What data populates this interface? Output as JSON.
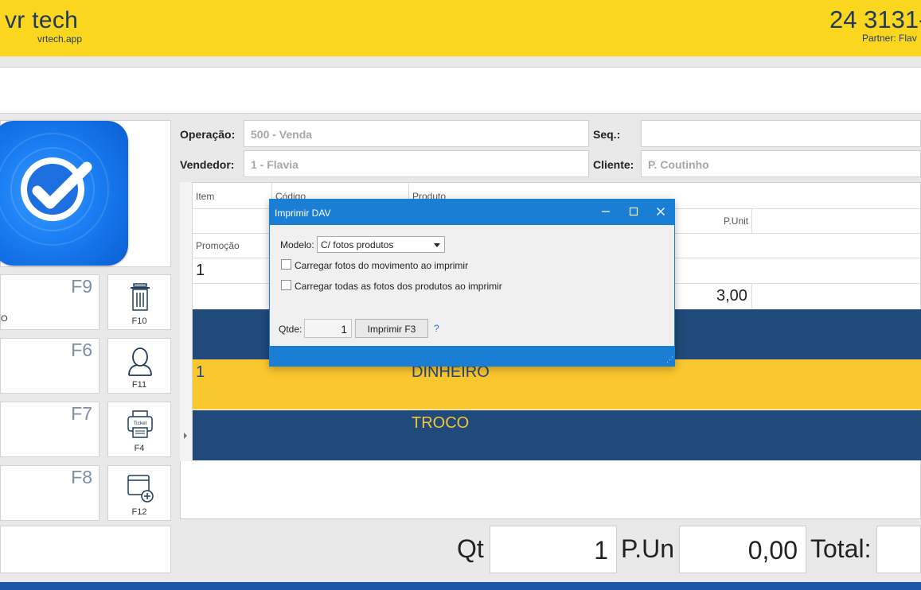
{
  "header": {
    "brand": "vr tech",
    "brand_sub": "vrtech.app",
    "phone": "24 3131-",
    "partner": "Partner: Flav"
  },
  "function_keys": [
    {
      "key": "F9",
      "fragment": "O"
    },
    {
      "key": "F6",
      "fragment": ""
    },
    {
      "key": "F7",
      "fragment": ""
    },
    {
      "key": "F8",
      "fragment": ""
    }
  ],
  "shortcut_buttons": [
    {
      "key": "F10",
      "icon": "trash-icon"
    },
    {
      "key": "F11",
      "icon": "user-icon"
    },
    {
      "key": "F4",
      "icon": "ticket-printer-icon",
      "icon_text": "Ticket"
    },
    {
      "key": "F12",
      "icon": "add-window-icon"
    }
  ],
  "form": {
    "operacao_label": "Operação:",
    "operacao_value": "500 - Venda",
    "seq_label": "Seq.:",
    "seq_value": "",
    "vendedor_label": "Vendedor:",
    "vendedor_value": "1 - Flavia",
    "cliente_label": "Cliente:",
    "cliente_value": "P. Coutinho"
  },
  "grid": {
    "headers": {
      "item": "Item",
      "codigo": "Código",
      "produto": "Produto",
      "punit": "P.Unit",
      "promocao": "Promoção"
    },
    "row_item": "1",
    "row_punit": "3,00",
    "bands": [
      {
        "item": "",
        "label": "",
        "color": "#1f4a7a"
      },
      {
        "item": "1",
        "label": "DINHEIRO",
        "color": "#fbc72f"
      },
      {
        "item": "",
        "label": "TROCO",
        "color": "#1f4a7a"
      }
    ]
  },
  "totals": {
    "qt_label": "Qt",
    "qt_value": "1",
    "pun_label": "P.Un",
    "pun_value": "0,00",
    "total_label": "Total:",
    "total_value": ""
  },
  "dialog": {
    "title": "Imprimir DAV",
    "modelo_label": "Modelo:",
    "modelo_value": "C/ fotos produtos",
    "check1": "Carregar fotos do movimento ao imprimir",
    "check2": "Carregar todas as fotos dos produtos ao imprimir",
    "qtde_label": "Qtde:",
    "qtde_value": "1",
    "print_button": "Imprimir F3",
    "help": "?"
  },
  "colors": {
    "header_yellow": "#fbd61e",
    "navy": "#1f4a7a",
    "band_yellow": "#fbc72f",
    "dialog_blue": "#1a7fd4",
    "troco_text": "#f6c33a"
  }
}
